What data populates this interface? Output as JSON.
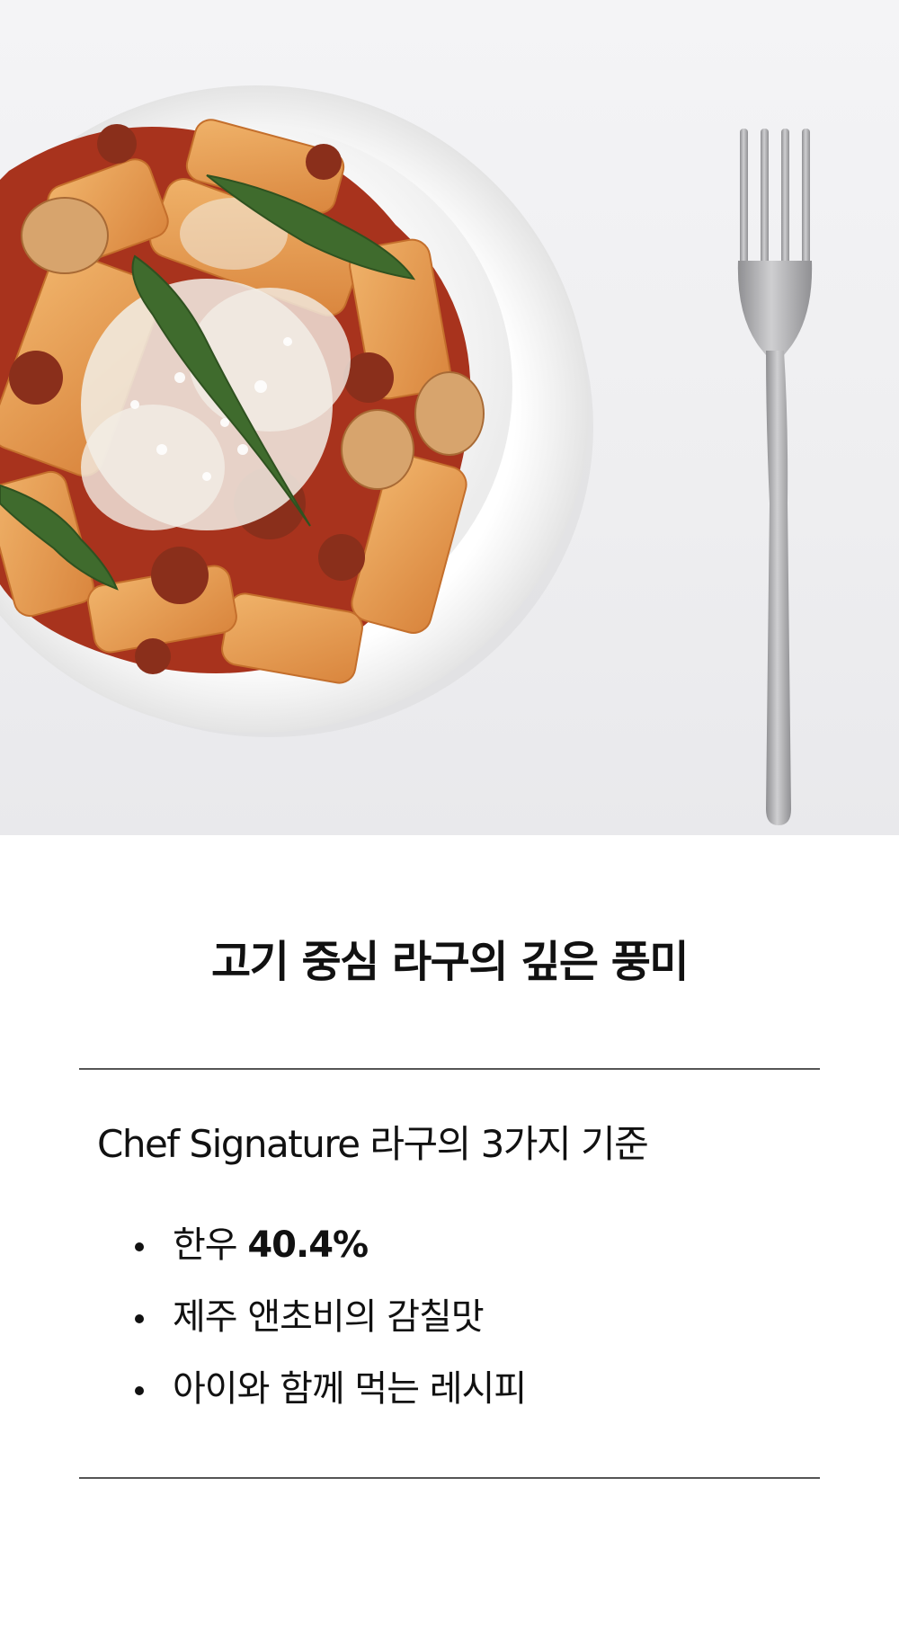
{
  "hero": {
    "dish_icon": "pasta-bowl-photo",
    "fork_icon": "fork-icon"
  },
  "title": "고기 중심 라구의 깊은 풍미",
  "subhead": "Chef Signature 라구의 3가지 기준",
  "bullets": [
    {
      "text": "한우",
      "highlight": "40.4%"
    },
    {
      "text": "제주 앤초비의 감칠맛"
    },
    {
      "text": "아이와 함께 먹는 레시피"
    }
  ],
  "colors": {
    "text": "#111111",
    "divider": "#555555",
    "plate": "#fbfbfb",
    "sauce": "#b33a22",
    "pasta": "#e49a4c",
    "arugula": "#3e6a2e",
    "cheese": "#f1ede4",
    "fork": "#a9a9ab"
  }
}
